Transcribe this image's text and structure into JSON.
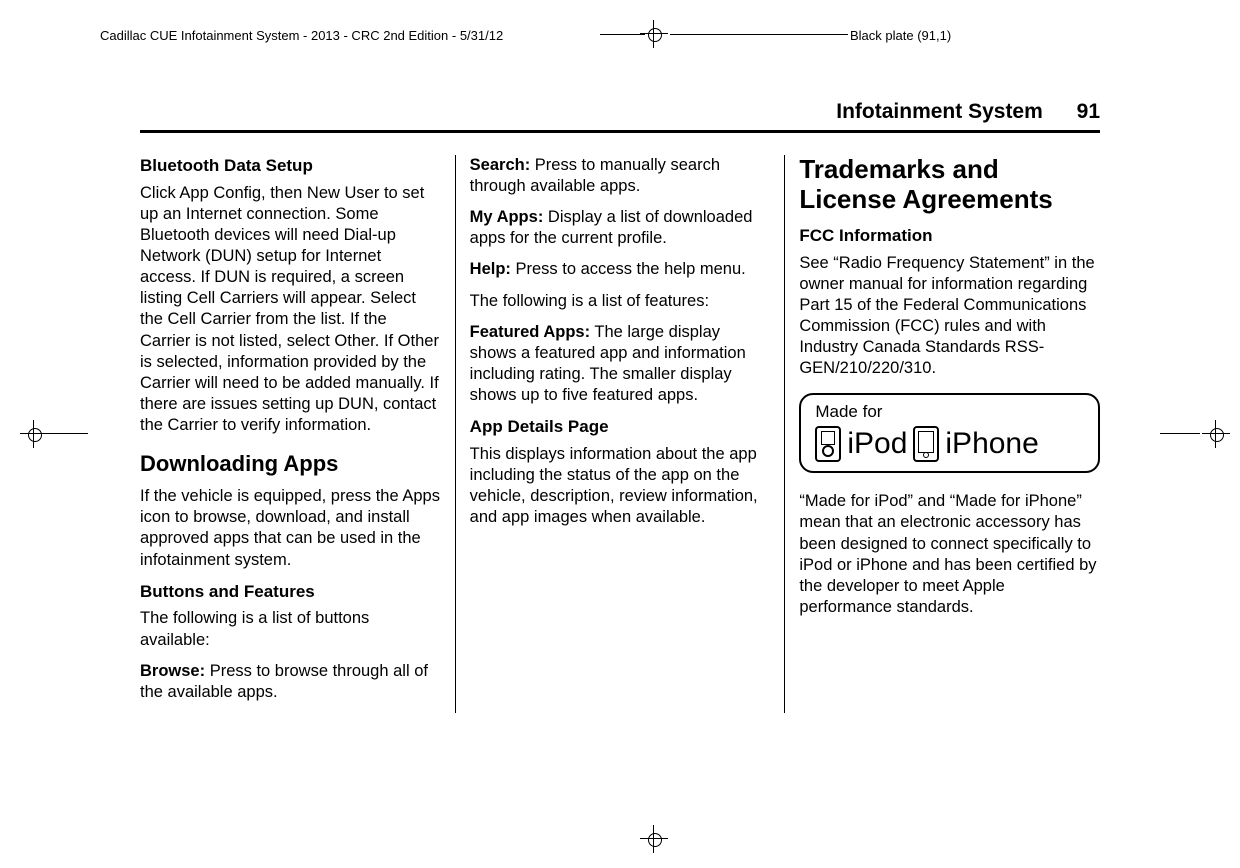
{
  "meta": {
    "doc_title": "Cadillac CUE Infotainment System - 2013 - CRC 2nd Edition - 5/31/12",
    "black_plate": "Black plate (91,1)"
  },
  "header": {
    "section": "Infotainment System",
    "page_no": "91"
  },
  "col1": {
    "h_bluetooth": "Bluetooth Data Setup",
    "p_bluetooth": "Click App Config, then New User to set up an Internet connection. Some Bluetooth devices will need Dial-up Network (DUN) setup for Internet access. If DUN is required, a screen listing Cell Carriers will appear. Select the Cell Carrier from the list. If the Carrier is not listed, select Other. If Other is selected, information provided by the Carrier will need to be added manually. If there are issues setting up DUN, contact the Carrier to verify information.",
    "h_downloading": "Downloading Apps",
    "p_downloading": "If the vehicle is equipped, press the Apps icon to browse, download, and install approved apps that can be used in the infotainment system.",
    "h_buttons": "Buttons and Features",
    "p_buttons_intro": "The following is a list of buttons available:",
    "browse_term": "Browse:",
    "browse_body": "  Press to browse through all of the available apps."
  },
  "col2": {
    "search_term": "Search:",
    "search_body": "  Press to manually search through available apps.",
    "myapps_term": "My Apps:",
    "myapps_body": "  Display a list of downloaded apps for the current profile.",
    "help_term": "Help:",
    "help_body": "  Press to access the help menu.",
    "features_intro": "The following is a list of features:",
    "featured_term": "Featured Apps:",
    "featured_body": "  The large display shows a featured app and information including rating. The smaller display shows up to five featured apps.",
    "h_appdetails": "App Details Page",
    "p_appdetails": "This displays information about the app including the status of the app on the vehicle, description, review information, and app images when available."
  },
  "col3": {
    "h_trademarks": "Trademarks and License Agreements",
    "h_fcc": "FCC Information",
    "p_fcc": "See “Radio Frequency Statement” in the owner manual for information regarding Part 15 of the Federal Communications Commission (FCC) rules and with Industry Canada Standards RSS-GEN/210/220/310.",
    "made_for_label": "Made for",
    "ipod": "iPod",
    "iphone": "iPhone",
    "p_madefor": "“Made for iPod” and “Made for iPhone” mean that an electronic accessory has been designed to connect specifically to iPod or iPhone and has been certified by the developer to meet Apple performance standards."
  }
}
